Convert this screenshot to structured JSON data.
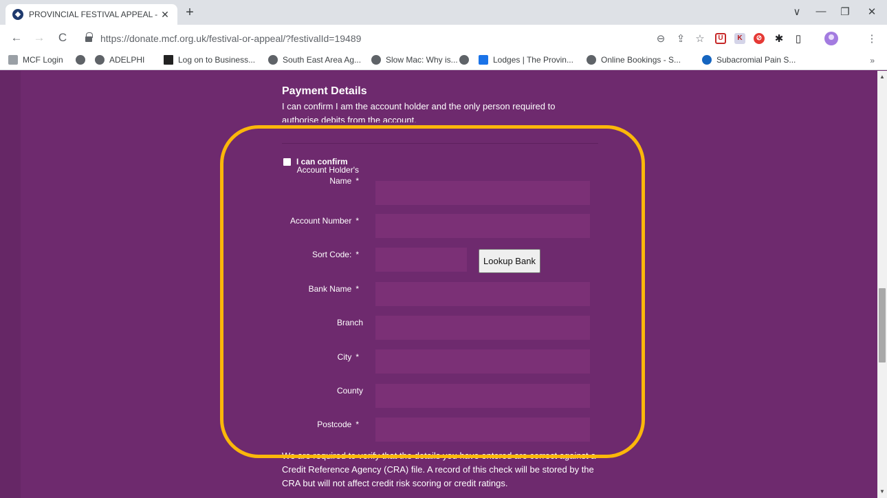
{
  "browser": {
    "tab_title": "PROVINCIAL FESTIVAL APPEAL - ",
    "tab_close": "✕",
    "new_tab": "+",
    "url": "https://donate.mcf.org.uk/festival-or-appeal/?festivalId=19489",
    "window_controls": {
      "chevron": "∨",
      "minimize": "—",
      "restore": "❐",
      "close": "✕"
    },
    "nav": {
      "back": "←",
      "forward": "→",
      "reload": "C"
    },
    "toolbar_icons": {
      "zoom": "⊖",
      "share": "⇪",
      "star": "☆",
      "extensions": "✱",
      "sidepanel": "▯",
      "menu": "⋮"
    },
    "extension_labels": {
      "ublock": "U",
      "k": "K",
      "block": "⊘"
    },
    "bookmarks": [
      {
        "label": "MCF Login",
        "icon": "mcf-icon"
      },
      {
        "label": "",
        "icon": "globe-icon"
      },
      {
        "label": "ADELPHI",
        "icon": "globe-icon"
      },
      {
        "label": "Log on to Business...",
        "icon": "business-icon"
      },
      {
        "label": "South East Area Ag...",
        "icon": "globe-icon"
      },
      {
        "label": "Slow Mac: Why is...",
        "icon": "globe-icon"
      },
      {
        "label": "",
        "icon": "globe-icon"
      },
      {
        "label": "Lodges | The Provin...",
        "icon": "ccs-icon"
      },
      {
        "label": "Online Bookings - S...",
        "icon": "globe-icon"
      },
      {
        "label": "Subacromial Pain S...",
        "icon": "globe-blue-icon"
      }
    ],
    "bookmarks_more": "»"
  },
  "payment": {
    "title": "Payment Details",
    "description": "I can confirm I am the account holder and the only person required to authorise debits from the account.",
    "confirm_label": "I can confirm",
    "required_marker": "*",
    "fields": {
      "account_holder_name": "Account Holder's Name",
      "account_number": "Account Number",
      "sort_code": "Sort Code:",
      "bank_name": "Bank Name",
      "branch": "Branch",
      "city": "City",
      "county": "County",
      "postcode": "Postcode"
    },
    "lookup_button": "Lookup Bank",
    "verify_text": "We are required to verify that the details you have entered are correct against a Credit Reference Agency (CRA) file. A record of this check will be stored by the CRA but will not affect credit risk scoring or credit ratings."
  },
  "scrollbar": {
    "up": "▲",
    "down": "▼"
  },
  "colors": {
    "page_background": "#6e2a6e",
    "input_background": "#7b3076",
    "highlight": "#fbb70a"
  }
}
